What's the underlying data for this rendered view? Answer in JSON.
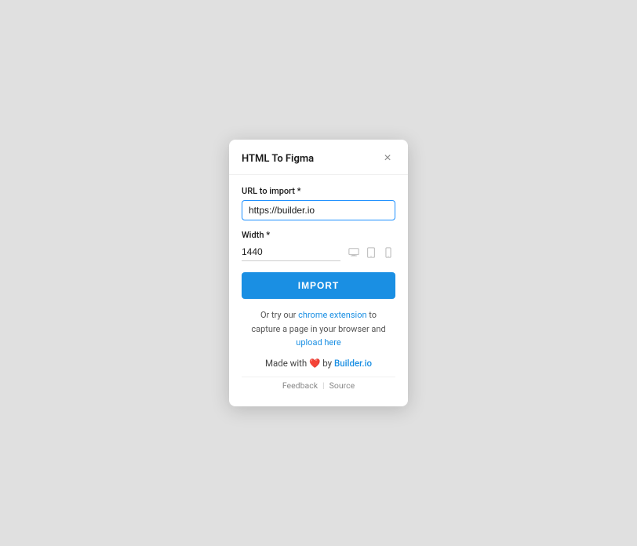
{
  "dialog": {
    "title": "HTML To Figma",
    "close_label": "×"
  },
  "url_field": {
    "label": "URL to import *",
    "value": "https://builder.io",
    "placeholder": "https://builder.io"
  },
  "width_field": {
    "label": "Width *",
    "value": "1440"
  },
  "import_button": {
    "label": "IMPORT"
  },
  "try_text": {
    "prefix": "Or try our ",
    "link1_label": "chrome extension",
    "link1_href": "#",
    "middle": " to\ncapture a page in your browser and\n",
    "link2_label": "upload here",
    "link2_href": "#"
  },
  "made_with": {
    "prefix": "Made with ",
    "heart": "❤️",
    "by": " by ",
    "brand_label": "Builder.io",
    "brand_href": "#"
  },
  "footer": {
    "feedback_label": "Feedback",
    "separator": "|",
    "source_label": "Source"
  },
  "device_icons": {
    "desktop": "desktop-icon",
    "tablet": "tablet-icon",
    "mobile": "mobile-icon"
  }
}
